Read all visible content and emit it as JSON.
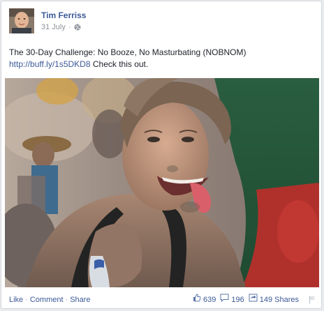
{
  "post": {
    "author": "Tim Ferriss",
    "date": "31 July",
    "privacy_icon": "globe-icon",
    "text_line": "The 30-Day Challenge: No Booze, No Masturbating (NOBNOM)",
    "link": "http://buff.ly/1s5DKD8",
    "link_suffix": " Check this out."
  },
  "footer": {
    "like": "Like",
    "comment": "Comment",
    "share": "Share",
    "separator": "·",
    "likes_count": "639",
    "comments_count": "196",
    "shares_count": "149 Shares"
  },
  "colors": {
    "link": "#3b5998",
    "text": "#1d2129",
    "muted": "#90949c"
  }
}
